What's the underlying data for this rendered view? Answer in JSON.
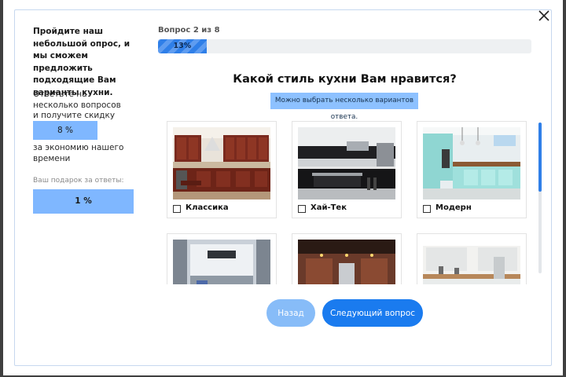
{
  "sidebar": {
    "title": "Пройдите наш небольшой опрос, и мы сможем предложить подходящие Вам варианты кухни.",
    "answer_prompt": "Ответьте на несколько вопросов и получите скидку",
    "discount_value": "8 %",
    "discount_note": "за экономию нашего времени",
    "gift_label": "Ваш подарок за ответы:",
    "gift_value": "1 %"
  },
  "progress": {
    "counter": "Вопрос 2 из 8",
    "percent_label": "13%",
    "fraction": 0.13
  },
  "question": {
    "title": "Какой стиль кухни Вам нравится?",
    "hint": "Можно выбрать несколько вариантов ответа."
  },
  "options": [
    {
      "label": "Классика",
      "checked": false
    },
    {
      "label": "Хай-Тек",
      "checked": false
    },
    {
      "label": "Модерн",
      "checked": false
    },
    {
      "label": "",
      "checked": false
    },
    {
      "label": "",
      "checked": false
    },
    {
      "label": "",
      "checked": false
    }
  ],
  "buttons": {
    "back": "Назад",
    "next": "Следующий вопрос"
  },
  "colors": {
    "accent": "#1a7bef",
    "accent_light": "#7fb7ff",
    "hint_bg": "#8dc1ff"
  }
}
